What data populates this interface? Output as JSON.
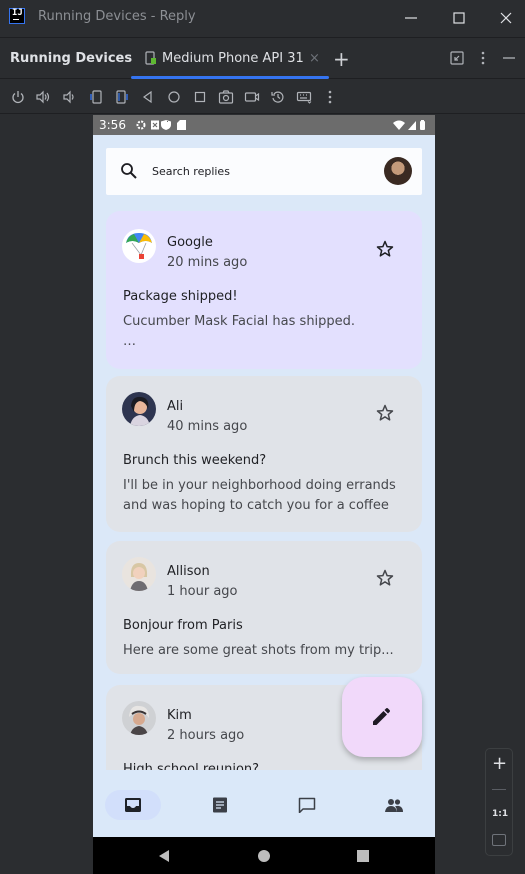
{
  "window": {
    "title": "Running Devices - Reply"
  },
  "toolwindow": {
    "title": "Running Devices",
    "tab_label": "Medium Phone API 31",
    "tab_close": "×",
    "add_tab": "+"
  },
  "device": {
    "status_time": "3:56",
    "search_placeholder": "Search replies",
    "emails": [
      {
        "sender": "Google",
        "time": "20 mins ago",
        "subject": "Package shipped!",
        "body": "Cucumber Mask Facial has shipped.\n…",
        "selected": true
      },
      {
        "sender": "Ali",
        "time": "40 mins ago",
        "subject": "Brunch this weekend?",
        "body": "I'll be in your neighborhood doing errands and was hoping to catch you for a coffee t…",
        "selected": false
      },
      {
        "sender": "Allison",
        "time": "1 hour ago",
        "subject": "Bonjour from Paris",
        "body": "Here are some great shots from my trip...",
        "selected": false
      },
      {
        "sender": "Kim",
        "time": "2 hours ago",
        "subject": "High school reunion?",
        "body": "",
        "selected": false
      }
    ],
    "nav_items": [
      "inbox-icon",
      "article-icon",
      "chat-icon",
      "contacts-icon"
    ]
  },
  "zoom": {
    "zoom_in": "+",
    "actual_size": "1:1"
  },
  "colors": {
    "ide_bg": "#2b2d30",
    "accent": "#3574f0",
    "app_bg": "#dbe8f8",
    "selected_card": "#e3e0fe",
    "card": "#e0e3e8",
    "fab": "#f1d9fa"
  }
}
